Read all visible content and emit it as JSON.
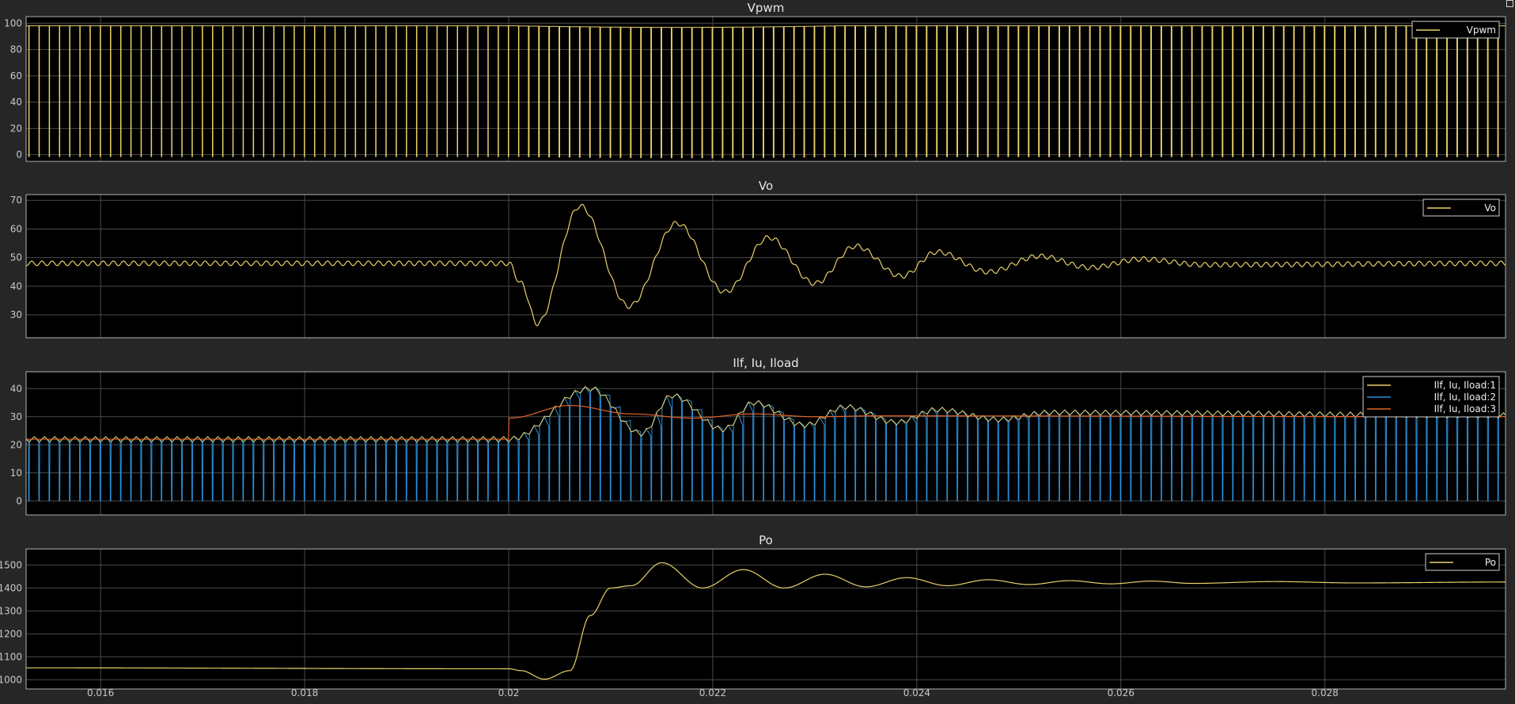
{
  "colors": {
    "yellow": "#e8d16a",
    "blue": "#2b8fd6",
    "orange": "#e0622a",
    "grid": "#4a4a4a",
    "axes": "#b0b0b0"
  },
  "xticks": [
    "0.016",
    "0.018",
    "0.02",
    "0.022",
    "0.024",
    "0.026",
    "0.028"
  ],
  "chart_data": [
    {
      "type": "line",
      "title": "Vpwm",
      "xlim": [
        0.01527,
        0.02977
      ],
      "ylim": [
        -5,
        105
      ],
      "yticks": [
        "0",
        "20",
        "40",
        "60",
        "80",
        "100"
      ],
      "yticks_values": [
        0,
        20,
        40,
        60,
        80,
        100
      ],
      "legend_position": "top-right",
      "series": [
        {
          "name": "Vpwm",
          "color": "#e8d16a",
          "kind": "pwm",
          "low": -1.5,
          "high": 98,
          "switching_period": 0.0001,
          "duty_before": 0.96,
          "duty_after": 0.93
        }
      ]
    },
    {
      "type": "line",
      "title": "Vo",
      "xlim": [
        0.01527,
        0.02977
      ],
      "ylim": [
        22,
        72
      ],
      "yticks": [
        "30",
        "40",
        "50",
        "60",
        "70"
      ],
      "yticks_values": [
        30,
        40,
        50,
        60,
        70
      ],
      "legend_position": "top-right",
      "series": [
        {
          "name": "Vo",
          "color": "#e8d16a",
          "points": [
            [
              0.01527,
              48
            ],
            [
              0.017,
              48
            ],
            [
              0.019,
              48
            ],
            [
              0.02,
              48
            ],
            [
              0.02012,
              41
            ],
            [
              0.02028,
              27
            ],
            [
              0.0207,
              68
            ],
            [
              0.02118,
              33
            ],
            [
              0.02165,
              62
            ],
            [
              0.02212,
              38
            ],
            [
              0.02255,
              57
            ],
            [
              0.023,
              41
            ],
            [
              0.0234,
              54
            ],
            [
              0.02385,
              43.5
            ],
            [
              0.0242,
              52
            ],
            [
              0.0247,
              45
            ],
            [
              0.0252,
              50.5
            ],
            [
              0.0257,
              46.5
            ],
            [
              0.0262,
              49.5
            ],
            [
              0.0268,
              47.5
            ],
            [
              0.02977,
              48
            ]
          ],
          "ripple_amplitude": 0.8,
          "ripple_period": 0.0001
        }
      ]
    },
    {
      "type": "line",
      "title": "Ilf, Iu, Iload",
      "xlim": [
        0.01527,
        0.02977
      ],
      "ylim": [
        -5,
        46
      ],
      "yticks": [
        "0",
        "10",
        "20",
        "30",
        "40"
      ],
      "yticks_values": [
        0,
        10,
        20,
        30,
        40
      ],
      "legend_position": "top-right",
      "series": [
        {
          "name": "Ilf, Iu, Iload:1",
          "color": "#e8d16a",
          "kind": "envelope"
        },
        {
          "name": "Ilf, Iu, Iload:2",
          "color": "#2b8fd6",
          "kind": "pulsed"
        },
        {
          "name": "Ilf, Iu, Iload:3",
          "color": "#e0622a",
          "points": [
            [
              0.01527,
              22
            ],
            [
              0.02,
              22
            ],
            [
              0.02001,
              29.5
            ],
            [
              0.0206,
              34
            ],
            [
              0.0212,
              31
            ],
            [
              0.0218,
              29.5
            ],
            [
              0.0224,
              31
            ],
            [
              0.023,
              30
            ],
            [
              0.0236,
              30.3
            ],
            [
              0.02977,
              30
            ]
          ]
        }
      ],
      "envelope_points": [
        [
          0.01527,
          22
        ],
        [
          0.02,
          22
        ],
        [
          0.0208,
          40
        ],
        [
          0.0213,
          24
        ],
        [
          0.0216,
          37.5
        ],
        [
          0.0221,
          25.5
        ],
        [
          0.0224,
          35
        ],
        [
          0.0229,
          27
        ],
        [
          0.0233,
          33.5
        ],
        [
          0.0238,
          28
        ],
        [
          0.0242,
          32.5
        ],
        [
          0.0248,
          29
        ],
        [
          0.0253,
          31.5
        ],
        [
          0.02977,
          30.5
        ]
      ],
      "envelope_ripple": 1.8
    },
    {
      "type": "line",
      "title": "Po",
      "xlim": [
        0.01527,
        0.02977
      ],
      "ylim": [
        960,
        1570
      ],
      "yticks": [
        "1000",
        "1100",
        "1200",
        "1300",
        "1400",
        "1500"
      ],
      "yticks_values": [
        1000,
        1100,
        1200,
        1300,
        1400,
        1500
      ],
      "legend_position": "top-right",
      "series": [
        {
          "name": "Po",
          "color": "#e8d16a",
          "points": [
            [
              0.01527,
              1052
            ],
            [
              0.02,
              1048
            ],
            [
              0.02012,
              1040
            ],
            [
              0.02035,
              1003
            ],
            [
              0.0206,
              1040
            ],
            [
              0.0208,
              1280
            ],
            [
              0.021,
              1400
            ],
            [
              0.0212,
              1410
            ],
            [
              0.0215,
              1510
            ],
            [
              0.0219,
              1400
            ],
            [
              0.0223,
              1480
            ],
            [
              0.0227,
              1400
            ],
            [
              0.0231,
              1460
            ],
            [
              0.0235,
              1405
            ],
            [
              0.0239,
              1445
            ],
            [
              0.0243,
              1410
            ],
            [
              0.0247,
              1436
            ],
            [
              0.0251,
              1415
            ],
            [
              0.0255,
              1432
            ],
            [
              0.0259,
              1418
            ],
            [
              0.0263,
              1430
            ],
            [
              0.0267,
              1420
            ],
            [
              0.0275,
              1428
            ],
            [
              0.0283,
              1422
            ],
            [
              0.02977,
              1426
            ]
          ]
        }
      ]
    }
  ]
}
